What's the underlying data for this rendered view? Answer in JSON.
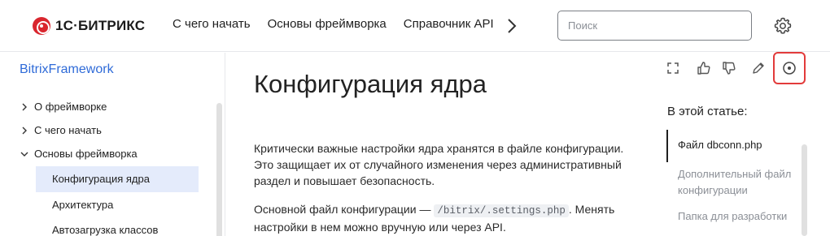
{
  "header": {
    "logo_text": "1С·БИТРИКС",
    "nav": [
      "С чего начать",
      "Основы фреймворка",
      "Справочник API"
    ],
    "search_placeholder": "Поиск"
  },
  "sidebar": {
    "title": "BitrixFramework",
    "items": [
      {
        "label": "О фреймворке",
        "expanded": false
      },
      {
        "label": "С чего начать",
        "expanded": false
      },
      {
        "label": "Основы фреймворка",
        "expanded": true
      }
    ],
    "subitems": [
      {
        "label": "Конфигурация ядра",
        "active": true
      },
      {
        "label": "Архитектура",
        "active": false
      },
      {
        "label": "Автозагрузка классов",
        "active": false
      }
    ]
  },
  "main": {
    "title": "Конфигурация ядра",
    "para1": "Критически важные настройки ядра хранятся в файле конфигурации. Это защищает их от случайного изменения через административный раздел и повышает безопасность.",
    "para2_before": "Основной файл конфигурации — ",
    "para2_code": "/bitrix/.settings.php",
    "para2_after": ". Менять настройки в нем можно вручную или через API."
  },
  "toolbar": {
    "icons": [
      "fullscreen-icon",
      "thumbs-up-icon",
      "thumbs-down-icon",
      "pencil-icon",
      "record-icon"
    ]
  },
  "toc": {
    "title": "В этой статье:",
    "items": [
      {
        "label": "Файл dbconn.php",
        "active": true
      },
      {
        "label": "Дополнительный файл конфигурации",
        "active": false
      },
      {
        "label": "Папка для разработки",
        "active": false
      }
    ]
  },
  "colors": {
    "accent_link": "#2f6bd8",
    "brand_red": "#d9262e",
    "active_bg": "#e4ebfb",
    "highlight": "#e23b3b"
  }
}
